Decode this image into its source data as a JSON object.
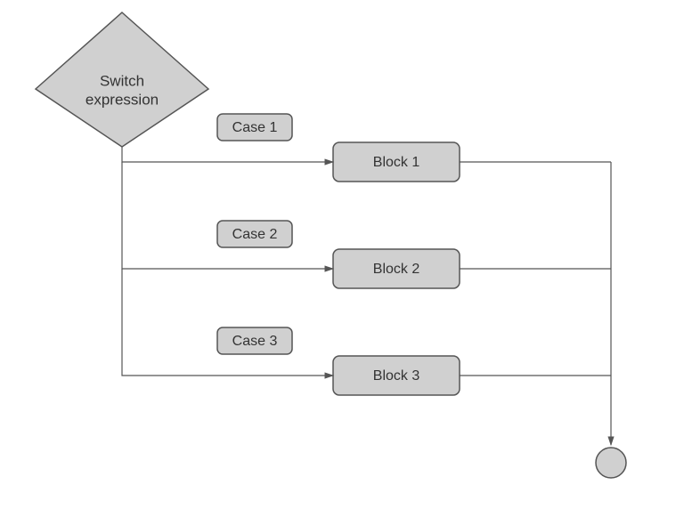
{
  "decision": {
    "line1": "Switch",
    "line2": "expression"
  },
  "cases": [
    {
      "label": "Case 1",
      "block": "Block 1"
    },
    {
      "label": "Case 2",
      "block": "Block 2"
    },
    {
      "label": "Case 3",
      "block": "Block 3"
    }
  ],
  "colors": {
    "shape_fill": "#d0d0d0",
    "stroke": "#555555",
    "text": "#333333"
  }
}
